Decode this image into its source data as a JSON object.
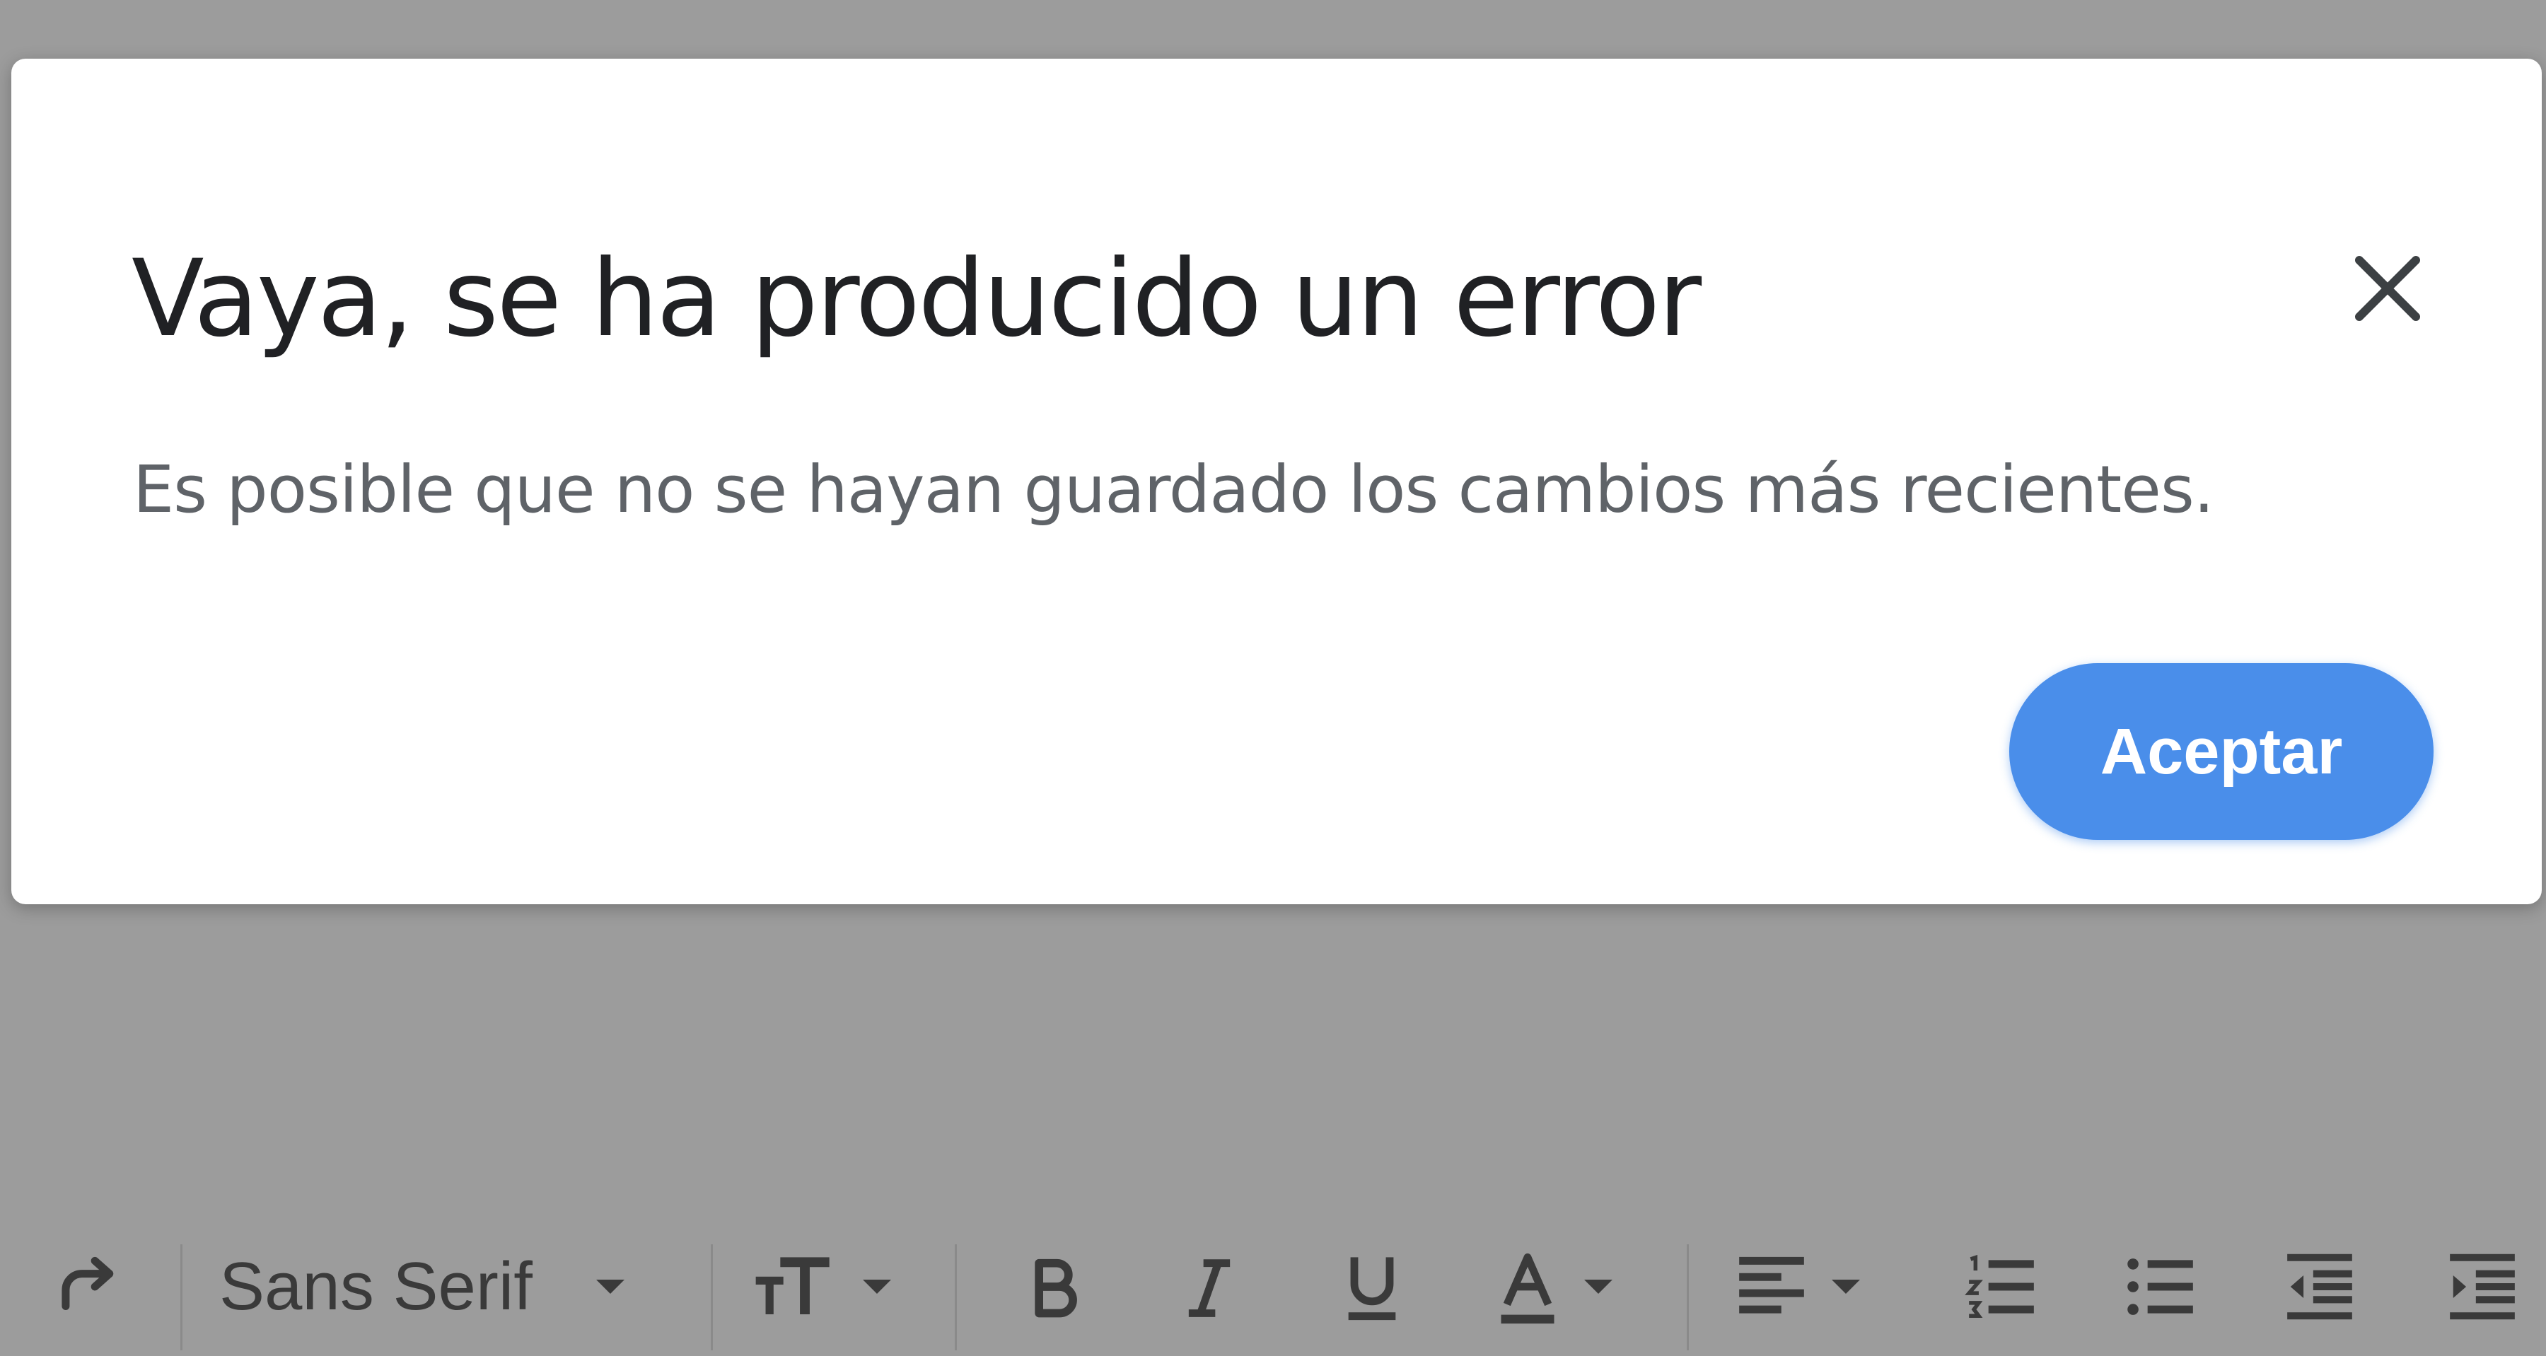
{
  "dialog": {
    "title": "Vaya, se ha producido un error",
    "message": "Es posible que no se hayan guardado los cambios más recientes.",
    "close_icon": "close-icon",
    "accept_label": "Aceptar"
  },
  "toolbar": {
    "font_family": "Sans Serif",
    "icons": [
      "redo-icon",
      "font-size-icon",
      "bold-icon",
      "italic-icon",
      "underline-icon",
      "text-color-icon",
      "align-icon",
      "numbered-list-icon",
      "bulleted-list-icon",
      "indent-less-icon",
      "indent-more-icon"
    ]
  },
  "colors": {
    "overlay": "#9c9c9c",
    "dialog_background": "#ffffff",
    "accent": "#4a8eea",
    "title_text": "#202124",
    "message_text": "#5f6368"
  }
}
